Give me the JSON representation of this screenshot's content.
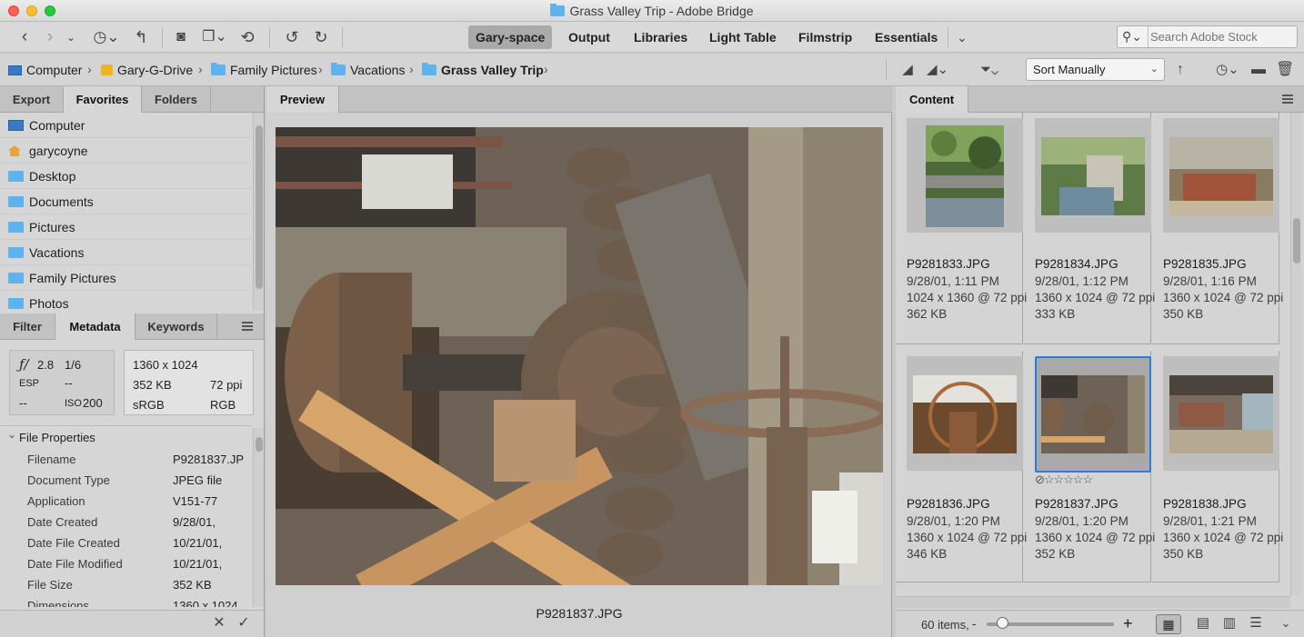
{
  "window": {
    "title": "Grass Valley Trip - Adobe Bridge"
  },
  "toolbar": {
    "workspaces": [
      "Gary-space",
      "Output",
      "Libraries",
      "Light Table",
      "Filmstrip",
      "Essentials"
    ],
    "active_workspace": "Gary-space",
    "search_placeholder": "Search Adobe Stock"
  },
  "path": {
    "crumbs": [
      "Computer",
      "Gary-G-Drive",
      "Family Pictures",
      "Vacations",
      "Grass Valley Trip"
    ],
    "sort": "Sort Manually"
  },
  "left_panel": {
    "tabs": [
      "Export",
      "Favorites",
      "Folders"
    ],
    "active_tab": "Favorites",
    "favorites": [
      {
        "label": "Computer",
        "icon": "computer-icon"
      },
      {
        "label": "garycoyne",
        "icon": "home-icon"
      },
      {
        "label": "Desktop",
        "icon": "folder-icon"
      },
      {
        "label": "Documents",
        "icon": "folder-icon"
      },
      {
        "label": "Pictures",
        "icon": "folder-icon"
      },
      {
        "label": "Vacations",
        "icon": "folder-icon"
      },
      {
        "label": "Family Pictures",
        "icon": "folder-icon"
      },
      {
        "label": "Photos",
        "icon": "folder-icon"
      }
    ],
    "lower_tabs": [
      "Filter",
      "Metadata",
      "Keywords"
    ],
    "lower_active_tab": "Metadata",
    "metadata_summary": {
      "aperture": "2.8",
      "shutter": "1/6",
      "exposure_mode": "ESP",
      "exposure_comp": "--",
      "metering": "--",
      "iso_label": "ISO",
      "iso": "200",
      "dimensions": "1360 x 1024",
      "size": "352 KB",
      "resolution": "72 ppi",
      "color_profile": "sRGB",
      "color_mode": "RGB"
    },
    "file_properties_title": "File Properties",
    "file_properties": [
      {
        "key": "Filename",
        "value": "P9281837.JP"
      },
      {
        "key": "Document Type",
        "value": "JPEG file"
      },
      {
        "key": "Application",
        "value": "V151-77"
      },
      {
        "key": "Date Created",
        "value": "9/28/01,"
      },
      {
        "key": "Date File Created",
        "value": "10/21/01,"
      },
      {
        "key": "Date File Modified",
        "value": "10/21/01,"
      },
      {
        "key": "File Size",
        "value": "352 KB"
      },
      {
        "key": "Dimensions",
        "value": "1360 x 1024"
      }
    ]
  },
  "preview": {
    "tab": "Preview",
    "caption": "P9281837.JPG"
  },
  "content": {
    "tab": "Content",
    "items": [
      {
        "name": "P9281833.JPG",
        "date": "9/28/01, 1:11 PM",
        "dims": "1024 x 1360 @ 72 ppi",
        "size": "362 KB"
      },
      {
        "name": "P9281834.JPG",
        "date": "9/28/01, 1:12 PM",
        "dims": "1360 x 1024 @ 72 ppi",
        "size": "333 KB"
      },
      {
        "name": "P9281835.JPG",
        "date": "9/28/01, 1:16 PM",
        "dims": "1360 x 1024 @ 72 ppi",
        "size": "350 KB"
      },
      {
        "name": "P9281836.JPG",
        "date": "9/28/01, 1:20 PM",
        "dims": "1360 x 1024 @ 72 ppi",
        "size": "346 KB"
      },
      {
        "name": "P9281837.JPG",
        "date": "9/28/01, 1:20 PM",
        "dims": "1360 x 1024 @ 72 ppi",
        "size": "352 KB"
      },
      {
        "name": "P9281838.JPG",
        "date": "9/28/01, 1:21 PM",
        "dims": "1360 x 1024 @ 72 ppi",
        "size": "350 KB"
      }
    ],
    "selected_item": "P9281837.JPG",
    "rating_stars": "☆☆☆☆☆",
    "item_count": "60 items,",
    "zoom_minus": "-",
    "zoom_plus": "+"
  },
  "colors": {
    "selection": "#2e7bd8",
    "folder": "#5eb3ec",
    "active_workspace_bg": "#a9a9a9"
  }
}
